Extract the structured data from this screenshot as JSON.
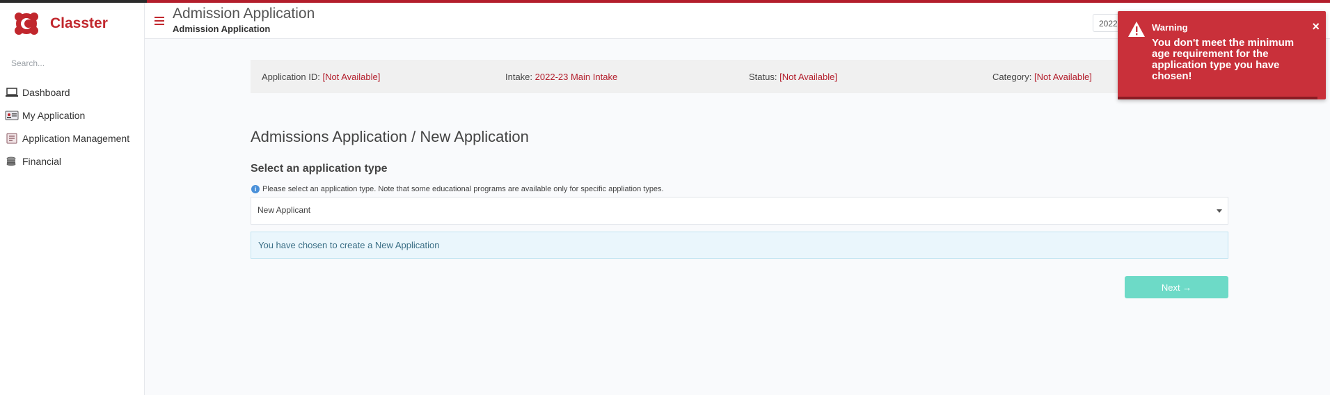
{
  "brand": {
    "name": "Classter",
    "accent_color": "#c1272d"
  },
  "sidebar": {
    "search_placeholder": "Search...",
    "items": [
      {
        "label": "Dashboard",
        "icon": "laptop-icon"
      },
      {
        "label": "My Application",
        "icon": "id-card-icon"
      },
      {
        "label": "Application Management",
        "icon": "application-management-icon"
      },
      {
        "label": "Financial",
        "icon": "coins-icon"
      }
    ]
  },
  "header": {
    "title": "Admission Application",
    "subtitle": "Admission Application",
    "period_select_value": "2022"
  },
  "info_bar": {
    "application_id_label": "Application ID:",
    "application_id_value": "[Not Available]",
    "intake_label": "Intake:",
    "intake_value": "2022-23 Main Intake",
    "status_label": "Status:",
    "status_value": "[Not Available]",
    "category_label": "Category:",
    "category_value": "[Not Available]"
  },
  "main": {
    "heading": "Admissions Application / New Application",
    "select_heading": "Select an application type",
    "hint": "Please select an application type. Note that some educational programs are available only for specific appliation types.",
    "application_type_value": "New Applicant",
    "info_message": "You have chosen to create a New Application",
    "next_label": "Next →",
    "next_color": "#6ddac7"
  },
  "toast": {
    "title": "Warning",
    "message": "You don't meet the minimum age requirement for the application type you have chosen!",
    "close_label": "×",
    "color": "#c9303a"
  }
}
